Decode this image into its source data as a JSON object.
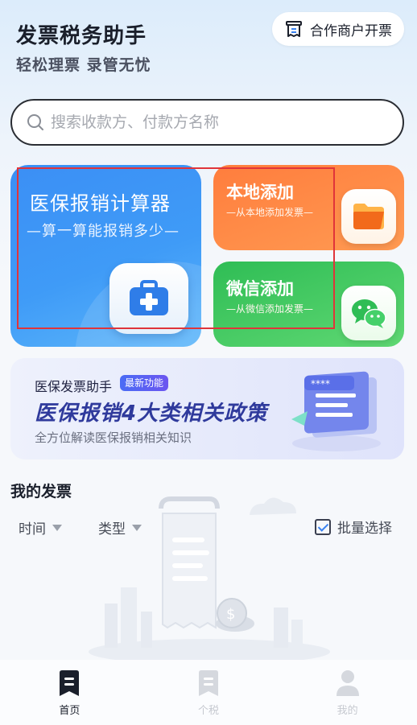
{
  "header": {
    "title": "发票税务助手",
    "subtitle": "轻松理票 录管无忧",
    "merchant_button": "合作商户开票"
  },
  "search": {
    "placeholder": "搜索收款方、付款方名称"
  },
  "cards": {
    "calculator": {
      "title": "医保报销计算器",
      "subtitle": "—算一算能报销多少—"
    },
    "local": {
      "title": "本地添加",
      "subtitle": "—从本地添加发票—"
    },
    "wechat": {
      "title": "微信添加",
      "subtitle": "—从微信添加发票—"
    }
  },
  "banner": {
    "brand": "医保发票助手",
    "badge": "最新功能",
    "headline": "医保报销4大类相关政策",
    "description": "全方位解读医保报销相关知识"
  },
  "invoices": {
    "title": "我的发票",
    "filter_time": "时间",
    "filter_type": "类型",
    "batch_select": "批量选择"
  },
  "tabbar": {
    "home": "首页",
    "tax": "个税",
    "mine": "我的"
  },
  "colors": {
    "calc_card": "#3f9bf7",
    "local_card": "#ff8a45",
    "wechat_card": "#3ecb61",
    "highlight_box": "#e0343a",
    "banner_headline": "#2f3a9c"
  }
}
